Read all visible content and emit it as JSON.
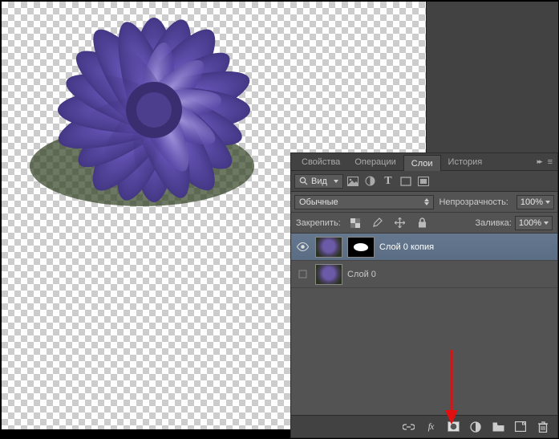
{
  "tabs": {
    "items": [
      "Свойства",
      "Операции",
      "Слои",
      "История"
    ],
    "active_index": 2
  },
  "kind_dropdown": {
    "label": "Вид"
  },
  "blend_mode": {
    "value": "Обычные"
  },
  "opacity": {
    "label": "Непрозрачность:",
    "value": "100%"
  },
  "lock_label": "Закрепить:",
  "fill": {
    "label": "Заливка:",
    "value": "100%"
  },
  "layers": [
    {
      "visible": true,
      "has_mask": true,
      "name": "Слой 0 копия",
      "selected": true
    },
    {
      "visible": false,
      "has_mask": false,
      "name": "Слой 0",
      "selected": false
    }
  ],
  "icons": {
    "eye": "eye-icon",
    "link": "link-icon",
    "fx": "fx",
    "mask": "mask-icon",
    "adjust": "adjustment-icon",
    "group": "group-folder-icon",
    "new": "new-layer-icon",
    "trash": "trash-icon",
    "search": "search-icon"
  }
}
